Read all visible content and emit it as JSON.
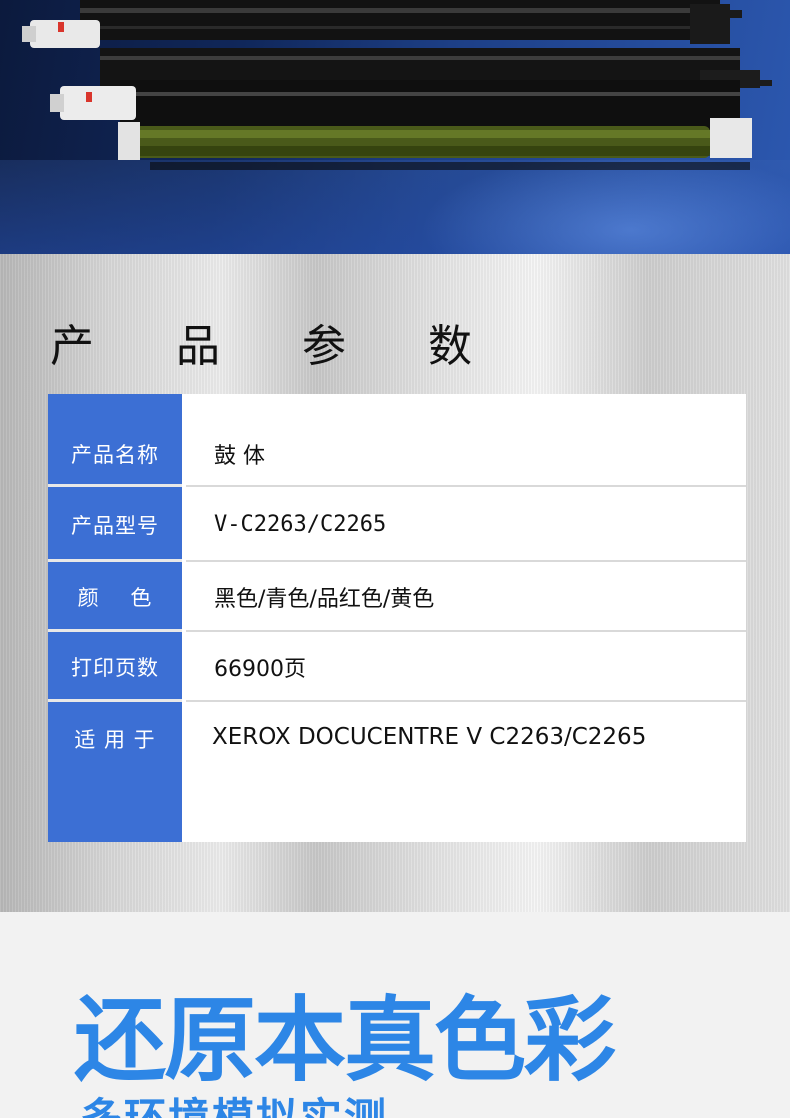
{
  "spec_section": {
    "title": "产 品 参 数",
    "rows": [
      {
        "label": "产品名称",
        "value": "鼓 体"
      },
      {
        "label": "产品型号",
        "value": "V-C2263/C2265"
      },
      {
        "label": "颜    色",
        "value": "黑色/青色/品红色/黄色"
      },
      {
        "label": "打印页数",
        "value": "66900页"
      },
      {
        "label": "适 用 于",
        "value": "XEROX DOCUCENTRE V C2263/C2265"
      }
    ]
  },
  "slogan": {
    "main": "还原本真色彩",
    "sub": "多环境模拟实测"
  },
  "colors": {
    "label_bg": "#3c6fd4",
    "slogan": "#2d86e6",
    "hero_bg": "#10275a"
  }
}
